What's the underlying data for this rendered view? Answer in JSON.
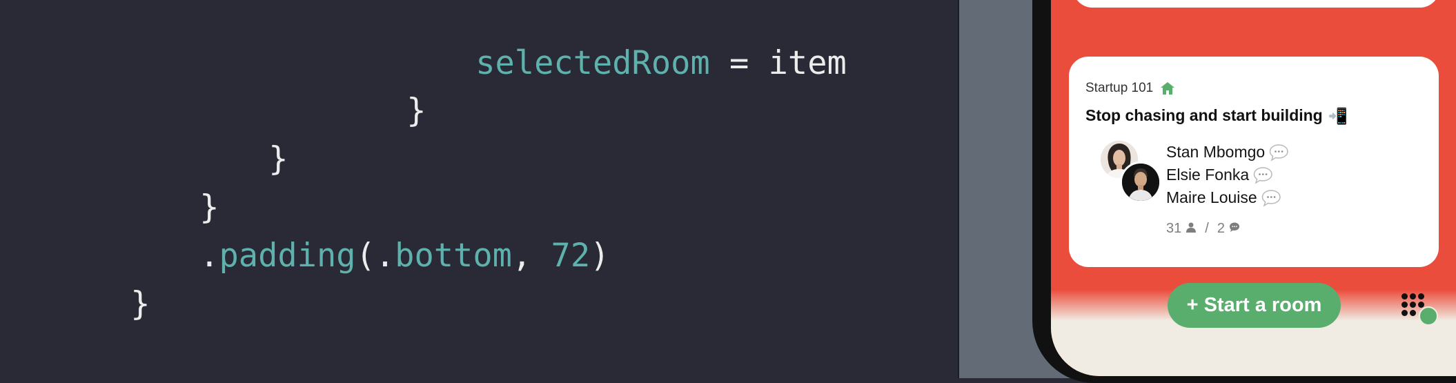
{
  "editor": {
    "lines": [
      {
        "prop": "selectedRoom",
        "rest": " = item"
      },
      {
        "text": "}"
      },
      {
        "text": "}"
      },
      {
        "text": "}"
      },
      {
        "dot1": ".",
        "fn": "padding",
        "paren_open": "(",
        "dot2": ".",
        "arg": "bottom",
        "comma": ", ",
        "num": "72",
        "paren_close": ")"
      },
      {
        "text": "}"
      }
    ]
  },
  "room_card": {
    "club": "Startup 101",
    "club_icon": "house-icon",
    "title": "Stop chasing and start building",
    "title_emoji": "📲",
    "speakers": [
      "Stan Mbomgo",
      "Elsie Fonka",
      "Maire Louise"
    ],
    "listeners": "31",
    "separator": "/",
    "speaker_count": "2"
  },
  "actions": {
    "start_room_label": "+ Start a room"
  },
  "colors": {
    "editor_bg": "#292a35",
    "code_token": "#5eb1ac",
    "screen_bg": "#eb4d3d",
    "green": "#59ad6d",
    "bottom_bar": "#f1ece3"
  }
}
